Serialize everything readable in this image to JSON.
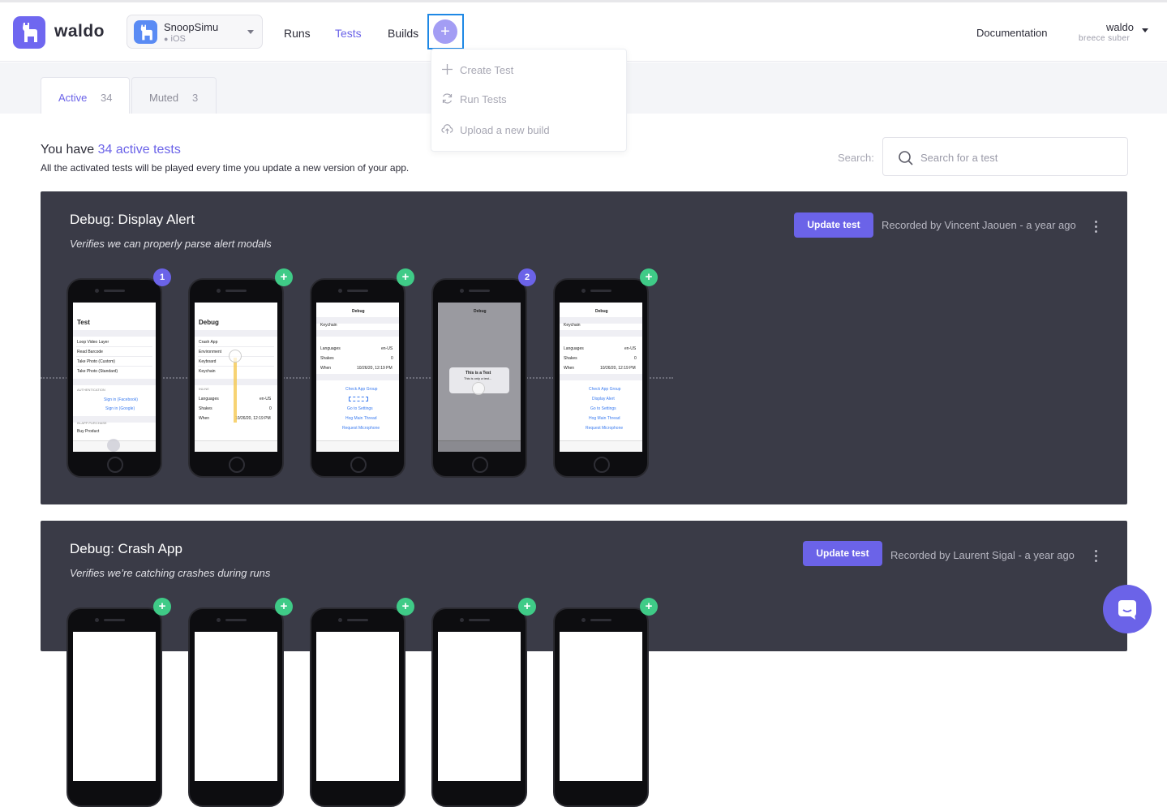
{
  "brand": {
    "name": "waldo"
  },
  "app": {
    "name": "SnoopSimu",
    "platform": "iOS"
  },
  "nav": [
    {
      "label": "Runs",
      "active": false
    },
    {
      "label": "Tests",
      "active": true
    },
    {
      "label": "Builds",
      "active": false
    }
  ],
  "header": {
    "documentation": "Documentation",
    "user_name": "waldo",
    "user_sub": "breece suber",
    "plus": "+"
  },
  "dropdown": {
    "items": [
      {
        "icon": "plus-icon",
        "label": "Create Test"
      },
      {
        "icon": "refresh-icon",
        "label": "Run Tests"
      },
      {
        "icon": "cloud-upload-icon",
        "label": "Upload a new build"
      }
    ]
  },
  "tabs": [
    {
      "label": "Active",
      "count": "34"
    },
    {
      "label": "Muted",
      "count": "3"
    }
  ],
  "summary": {
    "prefix": "You have ",
    "highlight": "34 active tests",
    "subtitle": "All the activated tests will be played every time you update a new version of your app."
  },
  "search": {
    "label": "Search:",
    "placeholder": "Search for a test"
  },
  "tests": [
    {
      "title": "Debug: Display Alert",
      "description": "Verifies we can properly parse alert modals",
      "button": "Update test",
      "recorded": "Recorded by Vincent Jaouen - a year ago",
      "badges": [
        "1",
        "+",
        "+",
        "2",
        "+"
      ]
    },
    {
      "title": "Debug: Crash App",
      "description": "Verifies we’re catching crashes during runs",
      "button": "Update test",
      "recorded": "Recorded by Laurent Sigal - a year ago",
      "badges": [
        "+",
        "+",
        "+",
        "+",
        "+"
      ]
    }
  ],
  "screens": {
    "s1": {
      "title": "Test",
      "rows": [
        "Loop Video Layer",
        "Read Barcode",
        "Take Photo (Custom)",
        "Take Photo (Standard)"
      ],
      "sec1": "AUTHENTICATION",
      "links": [
        "Sign in (Facebook)",
        "Sign in (Google)"
      ],
      "sec2": "IN-APP PURCHASE",
      "row2": "Buy Product"
    },
    "s2": {
      "title": "Debug",
      "rows": [
        "Crash App",
        "Environment",
        "Keyboard",
        "Keychain"
      ],
      "sec1": "INLINE",
      "kv": [
        [
          "Languages",
          "en-US"
        ],
        [
          "Shakes",
          "0"
        ],
        [
          "When",
          "10/26/20, 12:19 PM"
        ]
      ]
    },
    "s3": {
      "title": "Debug",
      "row": "Keychain",
      "kv": [
        [
          "Languages",
          "en-US"
        ],
        [
          "Shakes",
          "0"
        ],
        [
          "When",
          "10/26/20, 12:19 PM"
        ]
      ],
      "links": [
        "Check App Group",
        "Go to Settings",
        "Hog Main Thread",
        "Request Microphone"
      ]
    },
    "s4": {
      "title": "Debug",
      "alert_title": "This is a Test",
      "alert_body": "This is only a test..."
    },
    "s5": {
      "title": "Debug",
      "row": "Keychain",
      "kv": [
        [
          "Languages",
          "en-US"
        ],
        [
          "Shakes",
          "0"
        ],
        [
          "When",
          "10/26/20, 12:19 PM"
        ]
      ],
      "links": [
        "Check App Group",
        "Display Alert",
        "Go to Settings",
        "Hog Main Thread",
        "Request Microphone"
      ]
    }
  },
  "colors": {
    "accent": "#6b63e8",
    "card": "#3a3b47",
    "badge_plus": "#3fcb87",
    "plus_button": "#a39df4"
  }
}
